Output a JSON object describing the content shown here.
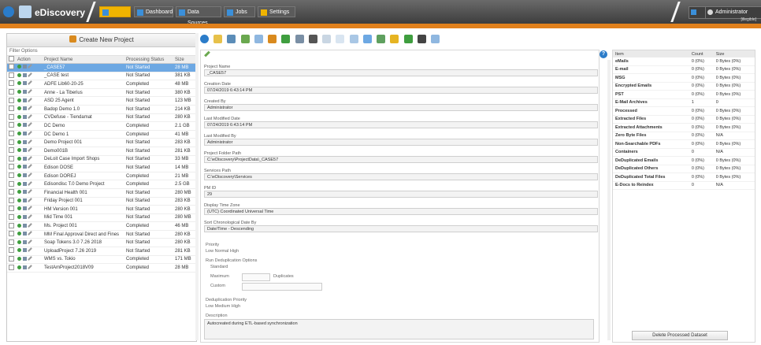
{
  "app": {
    "name": "eDiscovery"
  },
  "nav": [
    {
      "label": ""
    },
    {
      "label": "Dashboard"
    },
    {
      "label": "Data Sources"
    },
    {
      "label": "Jobs"
    },
    {
      "label": "Settings"
    }
  ],
  "user": {
    "label": "Administrator",
    "id": "[illegible]"
  },
  "left": {
    "create_label": "Create New Project",
    "filters_label": "Filter Options",
    "columns": [
      "Action",
      "Project Name",
      "Processing Status",
      "Size"
    ],
    "rows": [
      {
        "name": "_CASE57",
        "status": "Not Started",
        "size": "28 MB"
      },
      {
        "name": "_CASE test",
        "status": "Not Started",
        "size": "381 KB"
      },
      {
        "name": "ADFE Lib60-20-25",
        "status": "Completed",
        "size": "48 MB"
      },
      {
        "name": "Anne - La Tiberius",
        "status": "Not Started",
        "size": "380 KB"
      },
      {
        "name": "ASD 25 Agent",
        "status": "Not Started",
        "size": "123 MB"
      },
      {
        "name": "Badop Demo 1.0",
        "status": "Not Started",
        "size": "214 KB"
      },
      {
        "name": "CVDefuse - Tiendamat",
        "status": "Not Started",
        "size": "280 KB"
      },
      {
        "name": "DC Demo",
        "status": "Completed",
        "size": "2.1 GB"
      },
      {
        "name": "DC Demo 1",
        "status": "Completed",
        "size": "41 MB"
      },
      {
        "name": "Demo Project 001",
        "status": "Not Started",
        "size": "283 KB"
      },
      {
        "name": "Demo001B",
        "status": "Not Started",
        "size": "281 KB"
      },
      {
        "name": "DeLoit Case Import Shops",
        "status": "Not Started",
        "size": "33 MB"
      },
      {
        "name": "Edison DOSE",
        "status": "Not Started",
        "size": "14 MB"
      },
      {
        "name": "Edison DOREJ",
        "status": "Completed",
        "size": "21 MB"
      },
      {
        "name": "Edisondisc T.0 Demo Project",
        "status": "Completed",
        "size": "2.5 GB"
      },
      {
        "name": "Financial Health 001",
        "status": "Not Started",
        "size": "280 MB"
      },
      {
        "name": "Friday Project 001",
        "status": "Not Started",
        "size": "283 KB"
      },
      {
        "name": "HM Version 001",
        "status": "Not Started",
        "size": "280 KB"
      },
      {
        "name": "Mid Time 001",
        "status": "Not Started",
        "size": "280 MB"
      },
      {
        "name": "Ms. Project 001",
        "status": "Completed",
        "size": "46 MB"
      },
      {
        "name": "MM Final Approval Direct and Fines",
        "status": "Not Started",
        "size": "280 KB"
      },
      {
        "name": "Soap Tokens 3.0 7.26 2018",
        "status": "Not Started",
        "size": "280 KB"
      },
      {
        "name": "UploadProject 7.26 2019",
        "status": "Not Started",
        "size": "281 KB"
      },
      {
        "name": "WMS vs. Tokio",
        "status": "Completed",
        "size": "171 MB"
      },
      {
        "name": "TestAmProject2018V09",
        "status": "Completed",
        "size": "28 MB"
      }
    ]
  },
  "detail": {
    "fields": [
      {
        "label": "Project Name",
        "value": "_CASE57"
      },
      {
        "label": "Creation Date",
        "value": "07/24/2019 6:43:14 PM"
      },
      {
        "label": "Created By",
        "value": "Administrator"
      },
      {
        "label": "Last Modified Date",
        "value": "07/24/2019 6:43:14 PM"
      },
      {
        "label": "Last Modified By",
        "value": "Administrator"
      },
      {
        "label": "Project Folder Path",
        "value": "C:\\eDiscovery\\ProjectData\\_CASE57"
      },
      {
        "label": "Services Path",
        "value": "C:\\eDiscovery\\Services"
      },
      {
        "label": "PM ID",
        "value": "29"
      },
      {
        "label": "Display Time Zone",
        "value": "(UTC) Coordinated Universal Time"
      },
      {
        "label": "Sort Chronological Date By",
        "value": "Date/Time - Descending"
      }
    ],
    "priority_label": "Priority",
    "priority_options": "Low   Normal   High",
    "dedup_label": "Run Deduplication Options",
    "dedup_options": [
      "Standard",
      "Maximum",
      "Custom"
    ],
    "dedup_suffix": "Duplicates",
    "dedup_level_label": "Deduplication Priority",
    "dedup_level_options": "Low   Medium   High",
    "description_label": "Description",
    "description_value": "Autocreated during ETL-based synchronization"
  },
  "stats": {
    "columns": [
      "Item",
      "Count",
      "Size"
    ],
    "rows": [
      {
        "k": "eMails",
        "c": "0 (0%)",
        "s": "0 Bytes (0%)"
      },
      {
        "k": "E-mail",
        "c": "0 (0%)",
        "s": "0 Bytes (0%)"
      },
      {
        "k": "MSG",
        "c": "0 (0%)",
        "s": "0 Bytes (0%)"
      },
      {
        "k": "Encrypted Emails",
        "c": "0 (0%)",
        "s": "0 Bytes (0%)"
      },
      {
        "k": "PST",
        "c": "0 (0%)",
        "s": "0 Bytes (0%)"
      },
      {
        "k": "E-Mail Archives",
        "c": "1",
        "s": "0"
      },
      {
        "k": "Processed",
        "c": "0 (0%)",
        "s": "0 Bytes (0%)"
      },
      {
        "k": "Extracted Files",
        "c": "0 (0%)",
        "s": "0 Bytes (0%)"
      },
      {
        "k": "Extracted Attachments",
        "c": "0 (0%)",
        "s": "0 Bytes (0%)"
      },
      {
        "k": "Zero Byte Files",
        "c": "0 (0%)",
        "s": "N/A"
      },
      {
        "k": "Non-Searchable PDFs",
        "c": "0 (0%)",
        "s": "0 Bytes (0%)"
      },
      {
        "k": "Containers",
        "c": "0",
        "s": "N/A"
      },
      {
        "k": "DeDuplicated Emails",
        "c": "0 (0%)",
        "s": "0 Bytes (0%)"
      },
      {
        "k": "DeDuplicated Others",
        "c": "0 (0%)",
        "s": "0 Bytes (0%)"
      },
      {
        "k": "DeDuplicated Total Files",
        "c": "0 (0%)",
        "s": "0 Bytes (0%)"
      },
      {
        "k": "E-Docs to Reindex",
        "c": "0",
        "s": "N/A"
      }
    ],
    "delete_label": "Delete Processed Dataset"
  }
}
